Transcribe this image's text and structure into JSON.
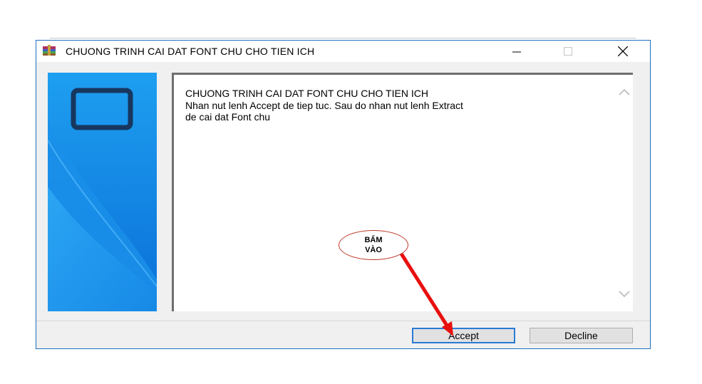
{
  "window": {
    "title": "CHUONG TRINH CAI DAT FONT CHU CHO TIEN ICH"
  },
  "content": {
    "text": "CHUONG TRINH CAI DAT FONT CHU CHO TIEN ICH\nNhan nut lenh Accept de tiep tuc. Sau do nhan nut lenh Extract\nde cai dat Font chu"
  },
  "buttons": {
    "accept_label": "Accept",
    "decline_label": "Decline"
  },
  "annotation": {
    "line1": "BẤM",
    "line2": "VÀO"
  },
  "icons": {
    "app": "winrar-archive-icon",
    "minimize": "minimize-icon",
    "maximize": "maximize-icon",
    "close": "close-icon",
    "scroll_up": "chevron-up-icon",
    "scroll_down": "chevron-down-icon"
  },
  "colors": {
    "window_border": "#1f6fc1",
    "accept_border": "#2a7ad6",
    "annotation_arrow": "#e8100f",
    "side_panel_blue": "#0a7be0"
  }
}
